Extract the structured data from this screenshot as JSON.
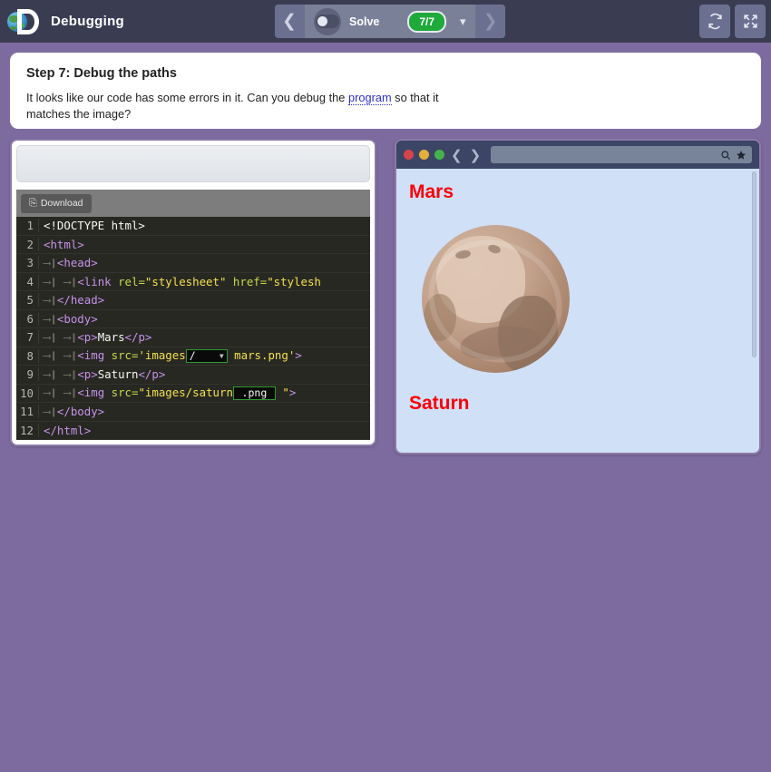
{
  "topbar": {
    "logo_icon": "globe-d-logo",
    "title": "Debugging",
    "prev_icon": "chevron-left-icon",
    "next_icon": "chevron-right-icon",
    "toggle_icon": "toggle-switch-icon",
    "mode_label": "Solve",
    "progress_badge": "7/7",
    "dropdown_icon": "chevron-down-icon",
    "refresh_icon": "refresh-icon",
    "fullscreen_icon": "fullscreen-icon"
  },
  "instruction": {
    "heading": "Step 7: Debug the paths",
    "body_before": "It looks like our code has some errors in it. Can you debug the ",
    "link_text": "program",
    "body_after": " so that it matches the image?"
  },
  "editor": {
    "download_label": "Download",
    "download_icon": "download-icon",
    "lines": [
      {
        "n": "1",
        "parts": [
          {
            "t": "txt",
            "v": "<!DOCTYPE html>"
          }
        ]
      },
      {
        "n": "2",
        "parts": [
          {
            "t": "tag",
            "v": "<html>"
          }
        ]
      },
      {
        "n": "3",
        "parts": [
          {
            "t": "tab",
            "v": "⟶❙"
          },
          {
            "t": "tag",
            "v": "<head>"
          }
        ]
      },
      {
        "n": "4",
        "parts": [
          {
            "t": "tab",
            "v": "⟶❙ ⟶❙"
          },
          {
            "t": "tag",
            "v": "<link "
          },
          {
            "t": "attr",
            "v": "rel="
          },
          {
            "t": "str",
            "v": "\"stylesheet\""
          },
          {
            "t": "attr",
            "v": " href="
          },
          {
            "t": "str",
            "v": "\"stylesh"
          }
        ]
      },
      {
        "n": "5",
        "parts": [
          {
            "t": "tab",
            "v": "⟶❙"
          },
          {
            "t": "tag",
            "v": "</head>"
          }
        ]
      },
      {
        "n": "6",
        "parts": [
          {
            "t": "tab",
            "v": "⟶❙"
          },
          {
            "t": "tag",
            "v": "<body>"
          }
        ]
      },
      {
        "n": "7",
        "parts": [
          {
            "t": "tab",
            "v": "⟶❙ ⟶❙"
          },
          {
            "t": "tag",
            "v": "<p>"
          },
          {
            "t": "txt",
            "v": "Mars"
          },
          {
            "t": "tag",
            "v": "</p>"
          }
        ]
      },
      {
        "n": "8",
        "parts": [
          {
            "t": "tab",
            "v": "⟶❙ ⟶❙"
          },
          {
            "t": "tag",
            "v": "<img "
          },
          {
            "t": "attr",
            "v": "src="
          },
          {
            "t": "str",
            "v": "'images"
          },
          {
            "t": "dd-select",
            "v": "/"
          },
          {
            "t": "str",
            "v": " mars.png'"
          },
          {
            "t": "tag",
            "v": ">"
          }
        ]
      },
      {
        "n": "9",
        "parts": [
          {
            "t": "tab",
            "v": "⟶❙ ⟶❙"
          },
          {
            "t": "tag",
            "v": "<p>"
          },
          {
            "t": "txt",
            "v": "Saturn"
          },
          {
            "t": "tag",
            "v": "</p>"
          }
        ]
      },
      {
        "n": "10",
        "parts": [
          {
            "t": "tab",
            "v": "⟶❙ ⟶❙"
          },
          {
            "t": "tag",
            "v": "<img "
          },
          {
            "t": "attr",
            "v": "src="
          },
          {
            "t": "str",
            "v": "\"images/saturn"
          },
          {
            "t": "dd-text",
            "v": ".png"
          },
          {
            "t": "str",
            "v": " \""
          },
          {
            "t": "tag",
            "v": ">"
          }
        ]
      },
      {
        "n": "11",
        "parts": [
          {
            "t": "tab",
            "v": "⟶❙"
          },
          {
            "t": "tag",
            "v": "</body>"
          }
        ]
      },
      {
        "n": "12",
        "parts": [
          {
            "t": "tag",
            "v": "</html>"
          }
        ]
      }
    ]
  },
  "preview": {
    "window_buttons": [
      "close-red",
      "minimize-yellow",
      "maximize-green"
    ],
    "back_icon": "chevron-left-icon",
    "forward_icon": "chevron-right-icon",
    "address_value": "",
    "search_icon": "search-icon",
    "bookmark_icon": "star-icon",
    "headings": [
      "Mars",
      "Saturn"
    ],
    "image_alt": "pluto-planet-image"
  },
  "colors": {
    "background": "#7d6ba0",
    "topbar": "#3a3d52",
    "accent_green": "#1faa3c",
    "heading_red": "#fb0007",
    "page_bg": "#cfe0f7",
    "code_bg": "#272822",
    "dropdown_border": "#2f9c2f"
  }
}
